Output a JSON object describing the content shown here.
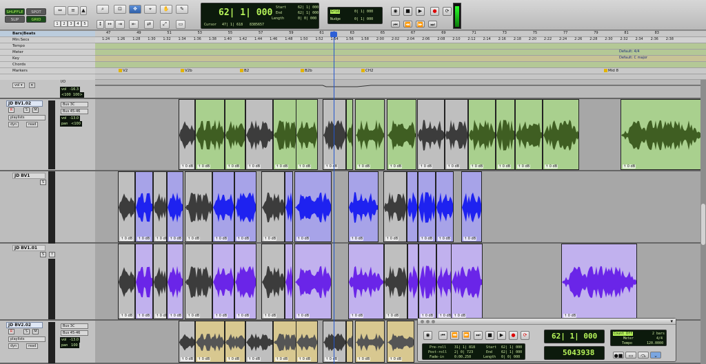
{
  "toolbar": {
    "modes": {
      "shuffle": "SHUFFLE",
      "spot": "SPOT",
      "slip": "SLIP",
      "grid": "GRID"
    },
    "zoom_presets": [
      "1",
      "2",
      "3",
      "4",
      "5"
    ],
    "main_counter": "62| 1| 000",
    "sel": {
      "start_label": "Start",
      "end_label": "End",
      "length_label": "Length",
      "start": "62| 1| 000",
      "end": "62| 1| 000",
      "length": "0| 0| 000"
    },
    "cursor_label": "Cursor",
    "cursor": "47| 1| 618",
    "sample": "8385657",
    "grid_label": "Grid",
    "grid": "0| 1| 000",
    "nudge_label": "Nudge",
    "nudge": "0| 1| 000"
  },
  "ruler": {
    "labels": [
      "Bars|Beats",
      "Min:Secs",
      "Tempo",
      "Meter",
      "Key",
      "Chords",
      "Markers"
    ],
    "bars": [
      "47",
      "49",
      "51",
      "53",
      "55",
      "57",
      "59",
      "61",
      "63",
      "65",
      "67",
      "69",
      "71",
      "73",
      "75",
      "77",
      "79",
      "81",
      "83"
    ],
    "mins": [
      "1:24",
      "1:26",
      "1:28",
      "1:30",
      "1:32",
      "1:34",
      "1:36",
      "1:38",
      "1:40",
      "1:42",
      "1:44",
      "1:46",
      "1:48",
      "1:50",
      "1:52",
      "1:54",
      "1:56",
      "1:58",
      "2:00",
      "2:02",
      "2:04",
      "2:06",
      "2:08",
      "2:10",
      "2:12",
      "2:14",
      "2:16",
      "2:18",
      "2:20",
      "2:22",
      "2:24",
      "2:26",
      "2:28",
      "2:30",
      "2:32",
      "2:34",
      "2:36",
      "2:38"
    ],
    "meter": "Default: 4/4",
    "key": "Default: C major",
    "markers": [
      "V2",
      "V2b",
      "B2",
      "B2b",
      "CH2",
      "Mid 8"
    ]
  },
  "tracks": [
    {
      "name": "",
      "sub": "I/O",
      "vol": "vol   -16.3",
      "pan": "<100  100>"
    },
    {
      "name": "JD BV1.02",
      "rec": "R",
      "solo": "S",
      "mute": "M",
      "playlist": "playlists",
      "dyn": "dyn",
      "mode": "read",
      "bus1": "Bus 3C",
      "bus2": "Bus 45-46",
      "vol": "vol   -13.0",
      "pan": "pan   <100"
    },
    {
      "name": "JD BV1"
    },
    {
      "name": "JD BV1.01"
    },
    {
      "name": "JD BV2.02",
      "rec": "R",
      "solo": "S",
      "mute": "M",
      "playlist": "playlists",
      "dyn": "dyn",
      "mode": "read",
      "bus1": "Bus 3C",
      "bus2": "Bus 45-46",
      "vol": "vol   -13.0",
      "pan": "pan   100"
    }
  ],
  "clip_gain": "0 dB",
  "transport": {
    "counter": "62| 1| 000",
    "samples": "5043938",
    "preroll_label": "Pre-roll",
    "postroll_label": "Post-roll",
    "fadein_label": "Fade-in",
    "preroll": "31| 1| 818",
    "postroll": "2| 0| 723",
    "fadein": "0:00.250",
    "start_label": "Start",
    "end_label": "End",
    "length_label": "Length",
    "start": "62| 1| 000",
    "end": "62| 1| 000",
    "length": "0| 0| 000",
    "cond": "Count Off",
    "cond_val": "2 bars",
    "meter_label": "Meter",
    "meter": "4/4",
    "tempo_label": "Tempo",
    "tempo": "120.0000"
  },
  "colors": {
    "green": "#a9d08e",
    "green_wave": "#3f5e22",
    "blue": "#a7a3e8",
    "blue_wave": "#1e22f0",
    "violet": "#c1b1ee",
    "violet_wave": "#6a25e8",
    "gray": "#bfbfbf",
    "gray_wave": "#3c3c3c",
    "yellow": "#d8c890"
  }
}
